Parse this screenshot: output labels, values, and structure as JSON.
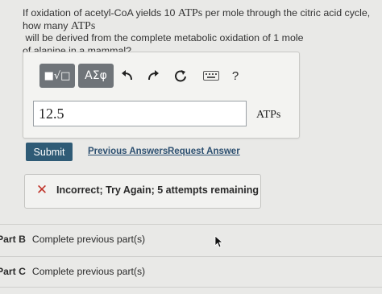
{
  "question": {
    "line1_a": "If oxidation of acetyl-CoA yields 10 ",
    "line1_unit": "ATPs",
    "line1_b": " per mole through the citric acid cycle,",
    "line2_a": "how many ",
    "line2_unit": "ATPs",
    "line2_b": " will be derived from the complete metabolic oxidation of 1 mole",
    "line3": "of alanine in a mammal?"
  },
  "toolbar": {
    "templates_glyph": "■√□",
    "greek_label": "ΑΣφ",
    "undo_icon": "undo-arrow-icon",
    "redo_icon": "redo-arrow-icon",
    "reset_icon": "reset-circle-icon",
    "keyboard_icon": "keyboard-icon",
    "help_label": "?"
  },
  "answer": {
    "value": "12.5",
    "unit": "ATPs"
  },
  "actions": {
    "submit_label": "Submit",
    "previous_answers_label": "Previous Answers",
    "request_answer_label": "Request Answer"
  },
  "feedback": {
    "icon": "x-mark-icon",
    "message": "Incorrect; Try Again; 5 attempts remaining",
    "color": "#c0352b"
  },
  "parts": [
    {
      "label": "Part B",
      "text": "Complete previous part(s)"
    },
    {
      "label": "Part C",
      "text": "Complete previous part(s)"
    }
  ],
  "colors": {
    "submit_bg": "#2f5b76",
    "toolbar_button_bg": "#6f7479",
    "link": "#2c4f70"
  }
}
